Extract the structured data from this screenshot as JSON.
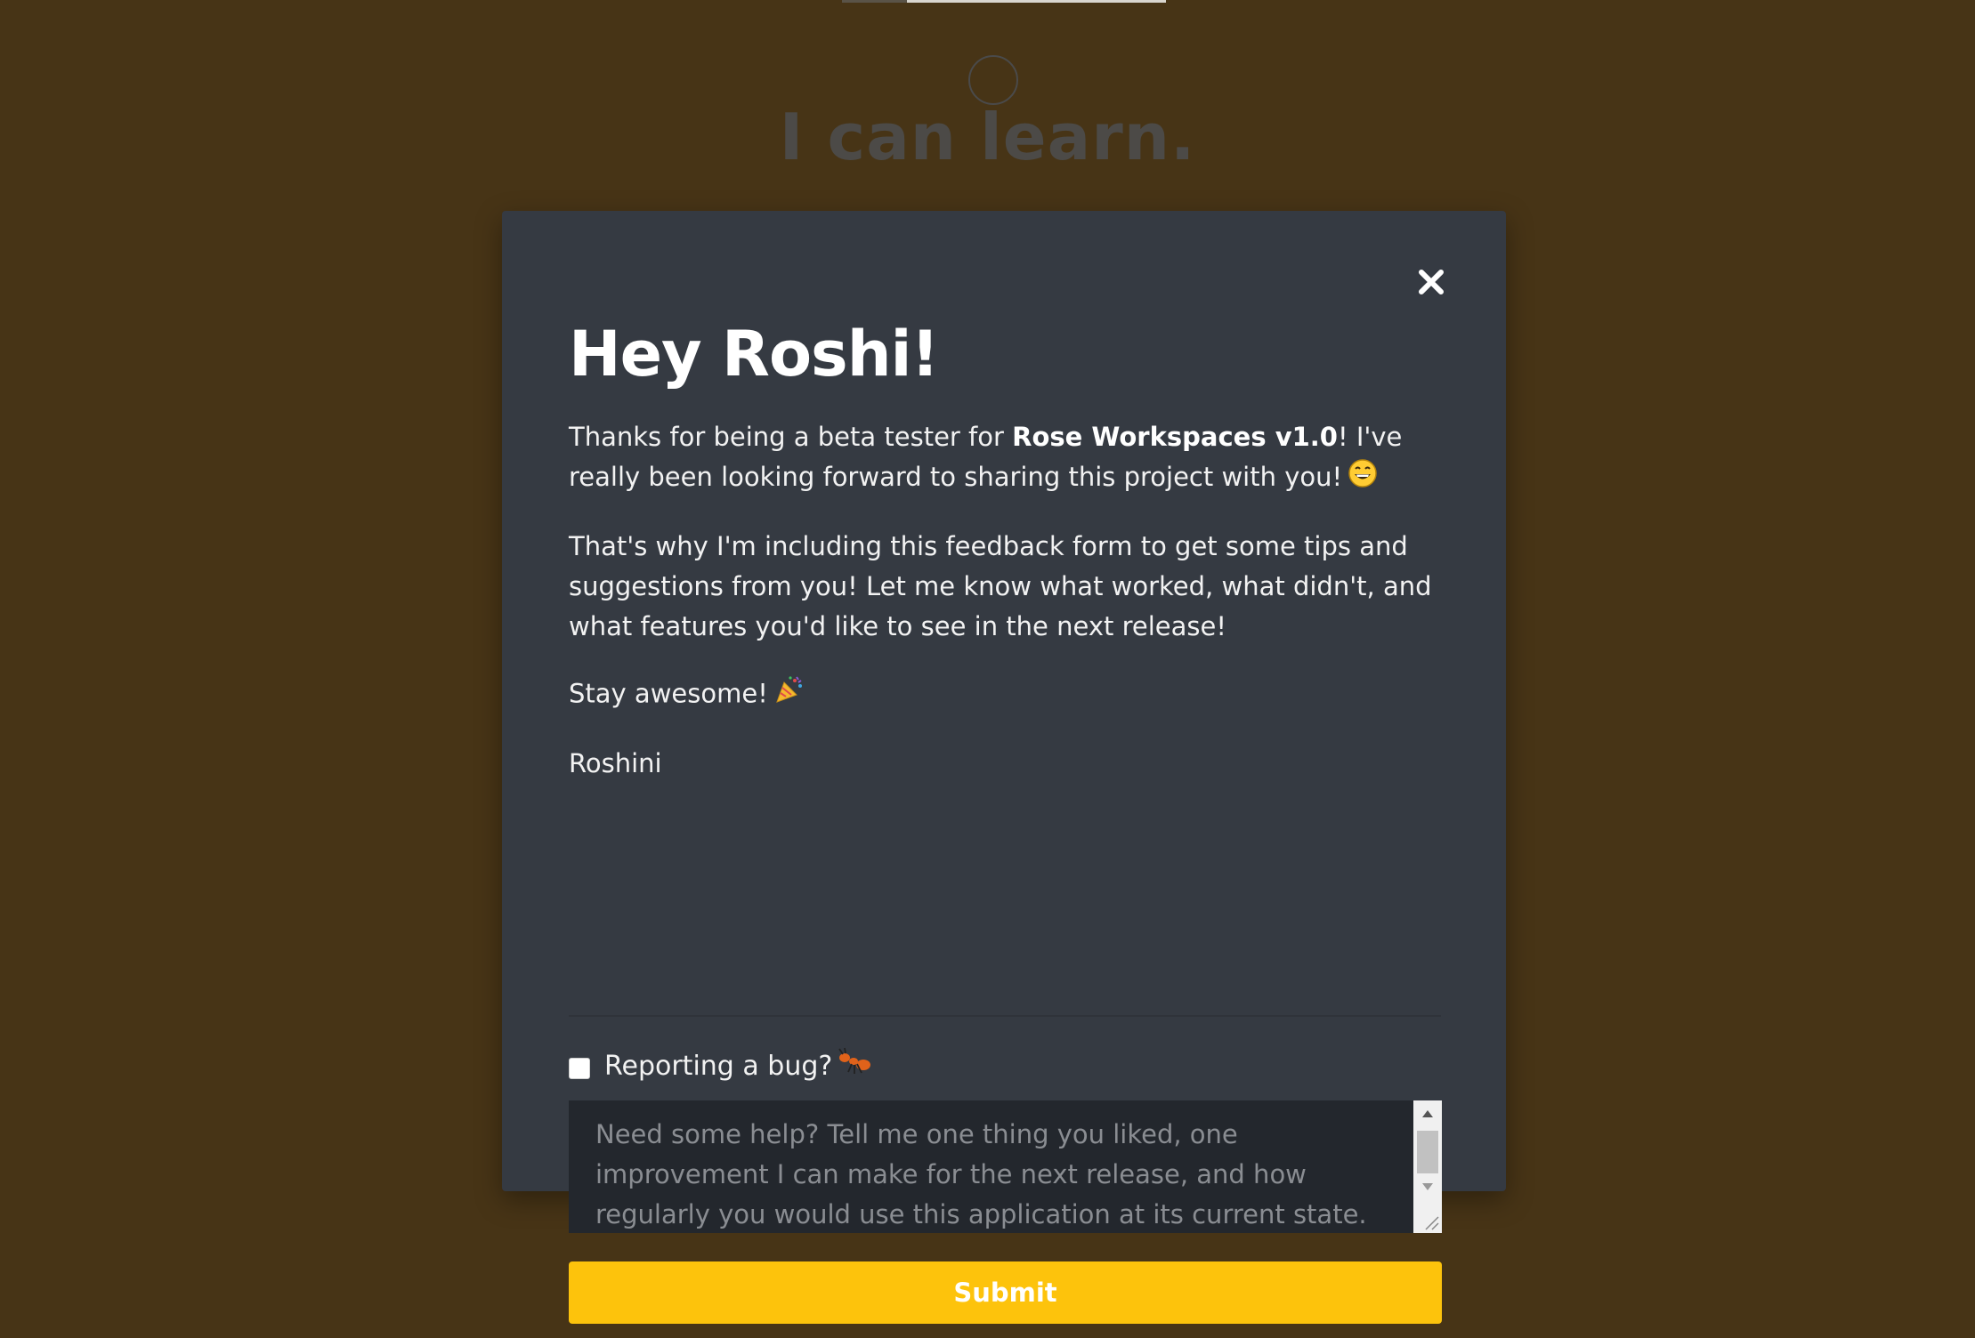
{
  "background": {
    "title": "I can learn."
  },
  "modal": {
    "heading": "Hey Roshi!",
    "para1_pre": "Thanks for being a beta tester for ",
    "para1_bold": "Rose Workspaces v1.0",
    "para1_post": "! I've really been looking forward to sharing this project with you!",
    "para1_emoji": "grinning-face-emoji",
    "para2": "That's why I'm including this feedback form to get some tips and suggestions from you! Let me know what worked, what didn't, and what features you'd like to see in the next release!",
    "para3": "Stay awesome!",
    "para3_emoji": "party-popper-emoji",
    "signature": "Roshini",
    "bug_label": "Reporting a bug?",
    "bug_emoji": "ant-emoji",
    "bug_checked": false,
    "feedback_placeholder": "Need some help? Tell me one thing you liked, one improvement I can make for the next release, and how regularly you would use this application at its current state.",
    "submit_label": "Submit",
    "close_icon": "close-icon"
  },
  "colors": {
    "page_background": "#473416",
    "modal_background": "#353a42",
    "textarea_background": "#23272d",
    "submit_background": "#fdc30c",
    "submit_text": "#ffffff"
  }
}
